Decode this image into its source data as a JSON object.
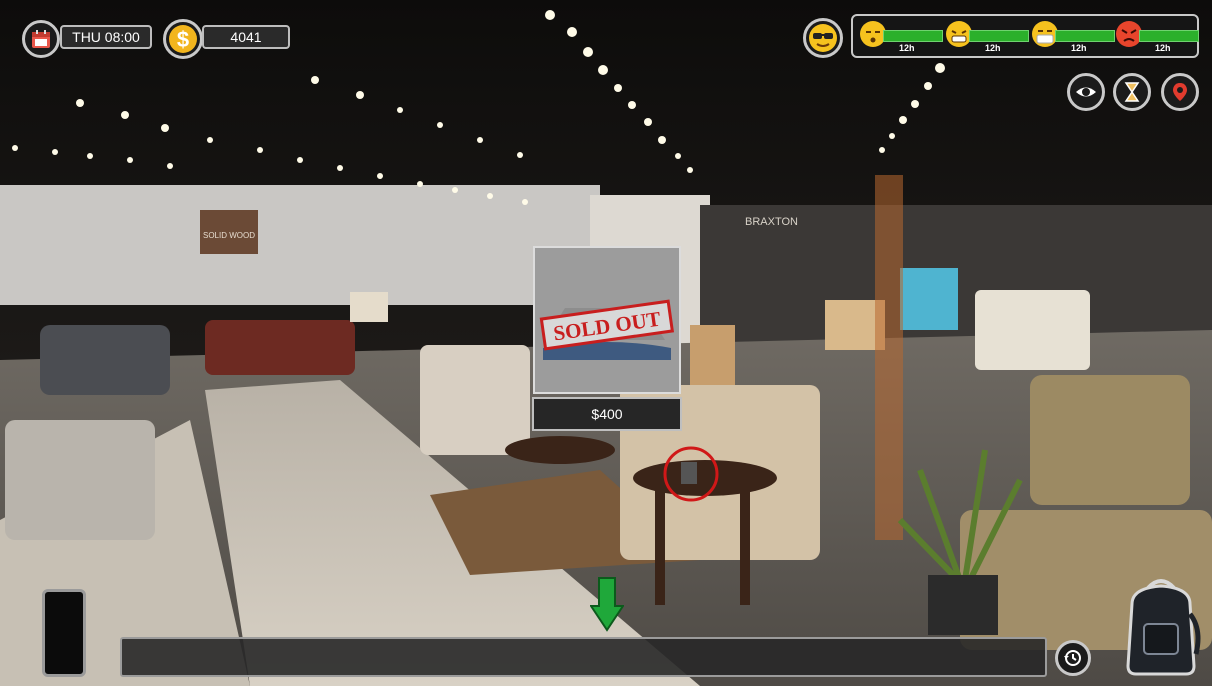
{
  "hud": {
    "day_time": "THU 08:00",
    "money": "4041",
    "calendar_icon": "calendar-icon",
    "money_icon": "dollar-coin-icon",
    "mood_icon": "cool-face-icon"
  },
  "needs": [
    {
      "icon": "sleepy-face-icon",
      "label": "12h",
      "level": 1.0,
      "color": "#2bb02b"
    },
    {
      "icon": "hungry-face-icon",
      "label": "12h",
      "level": 1.0,
      "color": "#2bb02b"
    },
    {
      "icon": "sick-face-icon",
      "label": "12h",
      "level": 1.0,
      "color": "#2bb02b"
    },
    {
      "icon": "angry-face-icon",
      "label": "12h",
      "level": 1.0,
      "color": "#2bb02b"
    }
  ],
  "top_right_buttons": [
    "eye-icon",
    "hourglass-icon",
    "map-pin-icon"
  ],
  "item_popup": {
    "stamp": "SOLD OUT",
    "price": "$400"
  },
  "bottom": {
    "message": "",
    "history_icon": "history-icon",
    "phone_icon": "phone-icon",
    "backpack_icon": "backpack-icon",
    "arrow_icon": "down-arrow-icon"
  },
  "scene_signs": {
    "left_sign": "SOLID WOOD",
    "right_sign": "BRAXTON"
  },
  "colors": {
    "accent_green": "#1fa83a",
    "highlight_red": "#d01818",
    "coin_yellow": "#f2b51d"
  }
}
